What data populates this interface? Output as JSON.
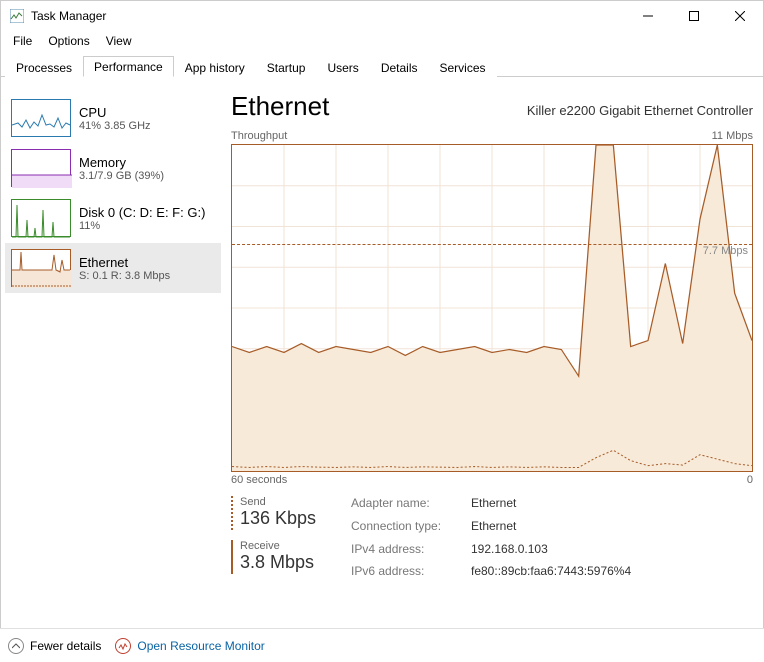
{
  "window": {
    "title": "Task Manager"
  },
  "menu": {
    "file": "File",
    "options": "Options",
    "view": "View"
  },
  "tabs": {
    "processes": "Processes",
    "performance": "Performance",
    "app_history": "App history",
    "startup": "Startup",
    "users": "Users",
    "details": "Details",
    "services": "Services"
  },
  "sidebar": {
    "cpu": {
      "title": "CPU",
      "sub": "41%  3.85 GHz",
      "color": "#2a7ab0"
    },
    "memory": {
      "title": "Memory",
      "sub": "3.1/7.9 GB (39%)",
      "color": "#8a2db0"
    },
    "disk": {
      "title": "Disk 0 (C: D: E: F: G:)",
      "sub": "11%",
      "color": "#3a8c2a"
    },
    "eth": {
      "title": "Ethernet",
      "sub": "S: 0.1 R: 3.8 Mbps",
      "color": "#a75c28"
    }
  },
  "main": {
    "title": "Ethernet",
    "adapter": "Killer e2200 Gigabit Ethernet Controller",
    "chart_top_left": "Throughput",
    "chart_top_right": "11 Mbps",
    "threshold_label": "7.7 Mbps",
    "chart_bottom_left": "60 seconds",
    "chart_bottom_right": "0"
  },
  "stats": {
    "send_label": "Send",
    "send_value": "136 Kbps",
    "receive_label": "Receive",
    "receive_value": "3.8 Mbps"
  },
  "info": {
    "adapter_name_k": "Adapter name:",
    "adapter_name_v": "Ethernet",
    "conn_type_k": "Connection type:",
    "conn_type_v": "Ethernet",
    "ipv4_k": "IPv4 address:",
    "ipv4_v": "192.168.0.103",
    "ipv6_k": "IPv6 address:",
    "ipv6_v": "fe80::89cb:faa6:7443:5976%4"
  },
  "footer": {
    "fewer": "Fewer details",
    "resmon": "Open Resource Monitor"
  },
  "chart_data": {
    "type": "line",
    "xlabel": "60 seconds",
    "ylabel": "Throughput",
    "ylim": [
      0,
      11
    ],
    "unit": "Mbps",
    "threshold": 7.7,
    "x_seconds_ago": [
      60,
      58,
      56,
      54,
      52,
      50,
      48,
      46,
      44,
      42,
      40,
      38,
      36,
      34,
      32,
      30,
      28,
      26,
      24,
      22,
      20,
      18,
      16,
      14,
      12,
      10,
      8,
      6,
      4,
      2,
      0
    ],
    "series": [
      {
        "name": "Receive",
        "values": [
          4.2,
          4.0,
          4.2,
          4.0,
          4.3,
          4.0,
          4.2,
          4.1,
          4.0,
          4.2,
          3.9,
          4.2,
          4.0,
          4.1,
          4.2,
          4.0,
          4.1,
          4.0,
          4.2,
          4.1,
          3.2,
          11.0,
          11.0,
          4.2,
          4.4,
          7.0,
          4.3,
          8.5,
          11.0,
          6.0,
          4.4
        ]
      },
      {
        "name": "Send",
        "values": [
          0.15,
          0.12,
          0.15,
          0.12,
          0.15,
          0.13,
          0.12,
          0.14,
          0.12,
          0.15,
          0.12,
          0.14,
          0.13,
          0.12,
          0.15,
          0.12,
          0.14,
          0.12,
          0.14,
          0.12,
          0.12,
          0.45,
          0.7,
          0.35,
          0.18,
          0.25,
          0.2,
          0.55,
          0.4,
          0.25,
          0.18
        ]
      }
    ]
  }
}
